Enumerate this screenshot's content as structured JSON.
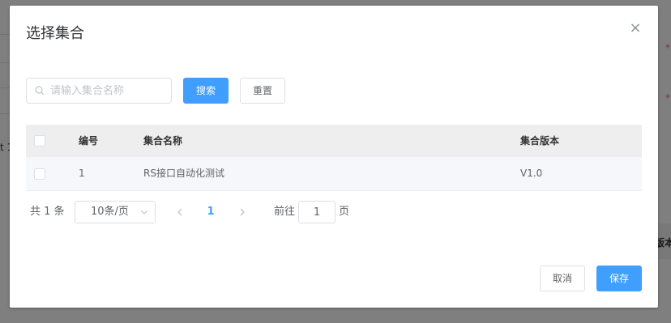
{
  "background": {
    "left_text": "t 1",
    "star_marks": [
      "*",
      "*"
    ],
    "right_header_text": "版本"
  },
  "dialog": {
    "title": "选择集合",
    "close_glyph": "×"
  },
  "search": {
    "placeholder": "请输入集合名称",
    "value": "",
    "search_label": "搜索",
    "reset_label": "重置"
  },
  "table": {
    "columns": [
      "编号",
      "集合名称",
      "集合版本"
    ],
    "rows": [
      {
        "no": "1",
        "name": "RS接口自动化测试",
        "version": "V1.0",
        "checked": false
      }
    ]
  },
  "pagination": {
    "total_text": "共 1 条",
    "page_size_text": "10条/页",
    "current_page": "1",
    "goto_prefix": "前往",
    "goto_value": "1",
    "goto_suffix": "页"
  },
  "footer": {
    "cancel_label": "取消",
    "save_label": "保存"
  },
  "colors": {
    "primary": "#409eff",
    "overlay": "rgba(0,0,0,0.5)",
    "header_bg": "#eeeeee",
    "row_bg": "#f5f7fa"
  },
  "icons": {
    "close": "close-icon",
    "search": "search-icon",
    "select_arrow": "chevron-down-icon",
    "prev": "chevron-left-icon",
    "next": "chevron-right-icon"
  }
}
